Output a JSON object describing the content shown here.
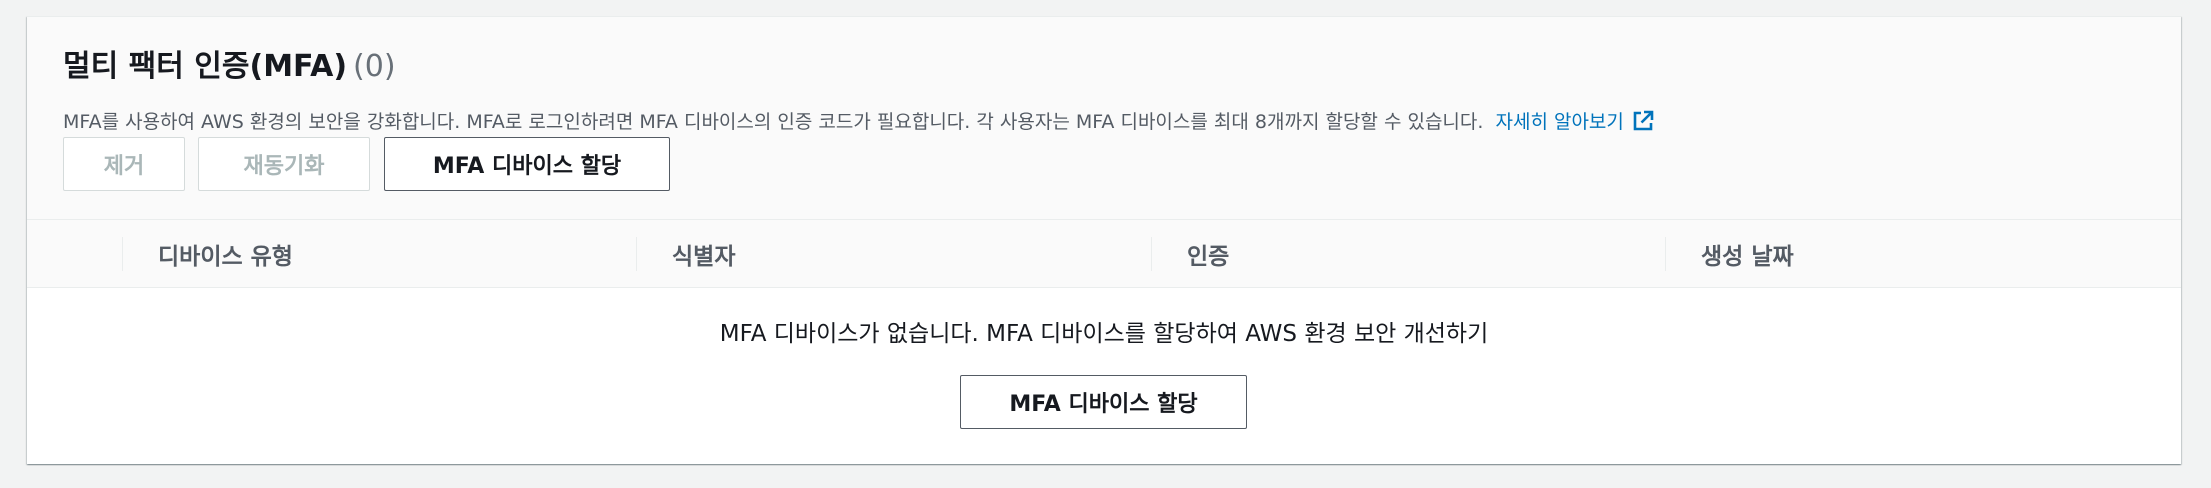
{
  "section": {
    "title": "멀티 팩터 인증(MFA)",
    "count": "(0)",
    "description": "MFA를 사용하여 AWS 환경의 보안을 강화합니다. MFA로 로그인하려면 MFA 디바이스의 인증 코드가 필요합니다. 각 사용자는 MFA 디바이스를 최대 8개까지 할당할 수 있습니다.",
    "learn_more": "자세히 알아보기",
    "learn_more_icon": "external-link-icon"
  },
  "toolbar": {
    "remove_label": "제거",
    "resync_label": "재동기화",
    "assign_label": "MFA 디바이스 할당"
  },
  "table": {
    "columns": [
      "디바이스 유형",
      "식별자",
      "인증",
      "생성 날짜"
    ]
  },
  "empty_state": {
    "message": "MFA 디바이스가 없습니다. MFA 디바이스를 할당하여 AWS 환경 보안 개선하기",
    "assign_label": "MFA 디바이스 할당"
  },
  "colors": {
    "link": "#0073bb",
    "disabled_text": "#aab7b8",
    "header_bg": "#fafafa",
    "page_bg": "#f2f3f3"
  }
}
